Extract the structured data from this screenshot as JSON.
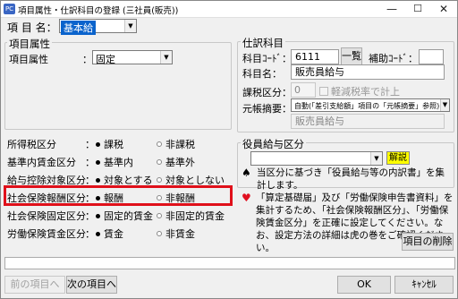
{
  "window": {
    "icon_text": "PC",
    "title": "項目属性・仕訳科目の登録 (三社員(販売))",
    "minimize": "—",
    "maximize": "☐",
    "close": "✕"
  },
  "header": {
    "label": "項 目 名：",
    "value": "基本給"
  },
  "left": {
    "group_label": "項目属性",
    "attr_label": "項目属性",
    "attr_value": "固定",
    "rows": [
      {
        "label": "所得税区分",
        "opt1": "課税",
        "opt2": "非課税",
        "selected": 1
      },
      {
        "label": "基準内賃金区分",
        "opt1": "基準内",
        "opt2": "基準外",
        "selected": 1
      },
      {
        "label": "給与控除対象区分",
        "opt1": "対象とする",
        "opt2": "対象としない",
        "selected": 1
      },
      {
        "label": "社会保険報酬区分",
        "opt1": "報酬",
        "opt2": "非報酬",
        "selected": 1
      },
      {
        "label": "社会保険固定区分",
        "opt1": "固定的賃金",
        "opt2": "非固定的賃金",
        "selected": 1
      },
      {
        "label": "労働保険賃金区分",
        "opt1": "賃金",
        "opt2": "非賃金",
        "selected": 1
      }
    ],
    "colon": "："
  },
  "journal": {
    "group_label": "仕訳科目",
    "code_label": "科目ｺｰﾄﾞ：",
    "code_value": "6111",
    "list_button": "一覧",
    "aux_label": "補助ｺｰﾄﾞ：",
    "name_label": "科目名：",
    "name_value": "販売員給与",
    "tax_label": "課税区分：",
    "tax_value": "0",
    "reduced_label": "軽減税率で計上",
    "summary_label": "元帳摘要：",
    "summary_value": "自動(「差引支給額」項目の「元帳摘要」参照)",
    "summary_text": "販売員給与"
  },
  "officer": {
    "group_label": "役員給与区分",
    "help_button": "解説",
    "spade_note": "当区分に基づき「役員給与等の内訳書」を集計します。",
    "heart_note": "「算定基礎届」及び「労働保険申告書資料」を集計するため、「社会保険報酬区分」、「労働保険賃金区分」を正確に設定してください。なお、設定方法の詳細は虎の巻をご確認ください。",
    "delete_button": "項目の削除"
  },
  "footer": {
    "prev_button": "前の項目へ",
    "next_button": "次の項目へ",
    "ok_button": "OK",
    "cancel_button": "ｷｬﾝｾﾙ"
  },
  "colors": {
    "highlight": "#e0101a",
    "selection": "#0a63cc",
    "yellow": "#ffff00",
    "heart": "#e01020"
  }
}
